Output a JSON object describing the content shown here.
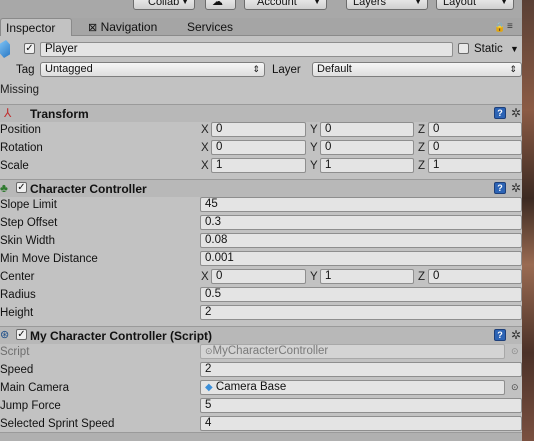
{
  "toolbar": {
    "collab_label": "Collab",
    "account_label": "Account",
    "layers_label": "Layers",
    "layout_label": "Layout"
  },
  "tabs": [
    {
      "label": "Inspector",
      "active": true
    },
    {
      "label": "Navigation",
      "active": false
    },
    {
      "label": "Services",
      "active": false
    }
  ],
  "object": {
    "name": "Player",
    "static_label": "Static",
    "tag_label": "Tag",
    "tag_value": "Untagged",
    "layer_label": "Layer",
    "layer_value": "Default",
    "missing_label": "Missing"
  },
  "transform": {
    "title": "Transform",
    "rows": [
      {
        "label": "Position",
        "x": "0",
        "y": "0",
        "z": "0"
      },
      {
        "label": "Rotation",
        "x": "0",
        "y": "0",
        "z": "0"
      },
      {
        "label": "Scale",
        "x": "1",
        "y": "1",
        "z": "1"
      }
    ]
  },
  "character_controller": {
    "title": "Character Controller",
    "slope_limit": {
      "label": "Slope Limit",
      "value": "45"
    },
    "step_offset": {
      "label": "Step Offset",
      "value": "0.3"
    },
    "skin_width": {
      "label": "Skin Width",
      "value": "0.08"
    },
    "min_move": {
      "label": "Min Move Distance",
      "value": "0.001"
    },
    "center": {
      "label": "Center",
      "x": "0",
      "y": "1",
      "z": "0"
    },
    "radius": {
      "label": "Radius",
      "value": "0.5"
    },
    "height": {
      "label": "Height",
      "value": "2"
    }
  },
  "script_component": {
    "title": "My Character Controller (Script)",
    "script": {
      "label": "Script",
      "value": "MyCharacterController"
    },
    "speed": {
      "label": "Speed",
      "value": "2"
    },
    "main_camera": {
      "label": "Main Camera",
      "value": "Camera Base"
    },
    "jump_force": {
      "label": "Jump Force",
      "value": "5"
    },
    "sprint_speed": {
      "label": "Selected Sprint Speed",
      "value": "4"
    }
  },
  "axes": {
    "x": "X",
    "y": "Y",
    "z": "Z"
  },
  "colors": {
    "help_icon": "#2d64b5",
    "cube_icon": "#3b8fd9"
  }
}
